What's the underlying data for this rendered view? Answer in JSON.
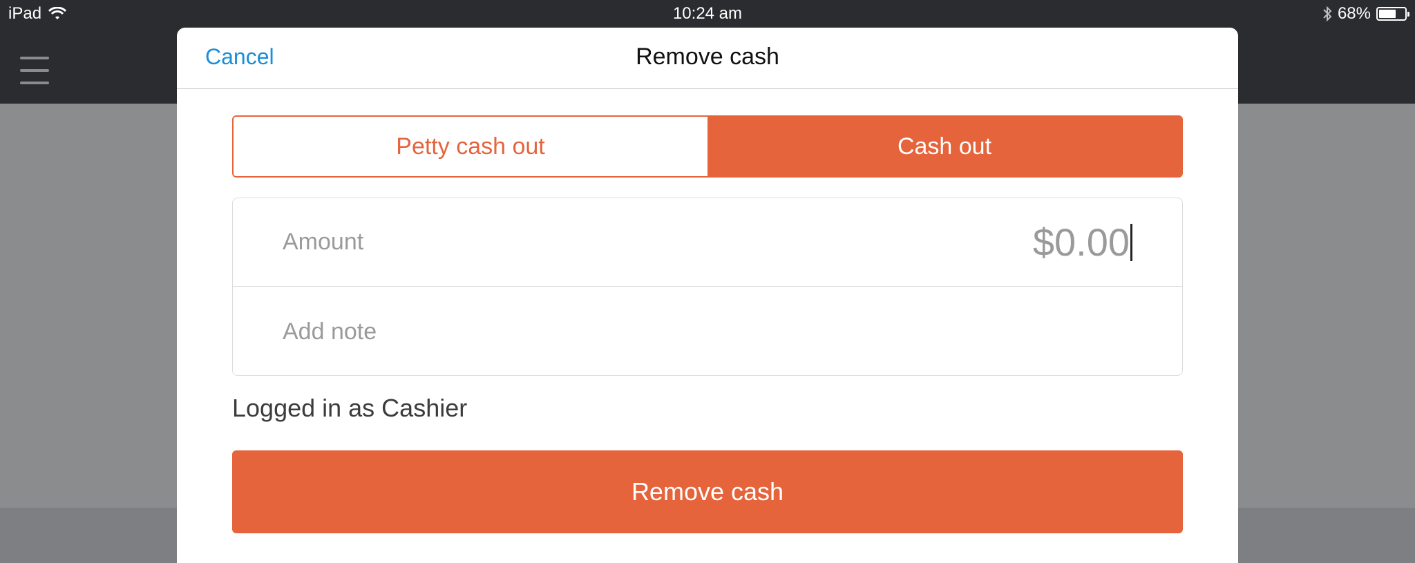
{
  "status_bar": {
    "device": "iPad",
    "time": "10:24 am",
    "battery_percent": "68%",
    "battery_level": 0.68,
    "icons": [
      "wifi-icon",
      "bluetooth-icon",
      "battery-icon"
    ]
  },
  "app": {
    "menu_icon": "hamburger-menu-icon"
  },
  "modal": {
    "cancel_label": "Cancel",
    "title": "Remove cash",
    "segments": [
      {
        "label": "Petty cash out",
        "selected": false
      },
      {
        "label": "Cash out",
        "selected": true
      }
    ],
    "amount_label": "Amount",
    "amount_value": "$0.00",
    "note_placeholder": "Add note",
    "logged_in_text": "Logged in as Cashier",
    "submit_label": "Remove cash"
  },
  "colors": {
    "accent": "#e5643b",
    "link": "#1a8ed8",
    "app_bar": "#2b2c2f",
    "backdrop": "#8b8c8e"
  }
}
